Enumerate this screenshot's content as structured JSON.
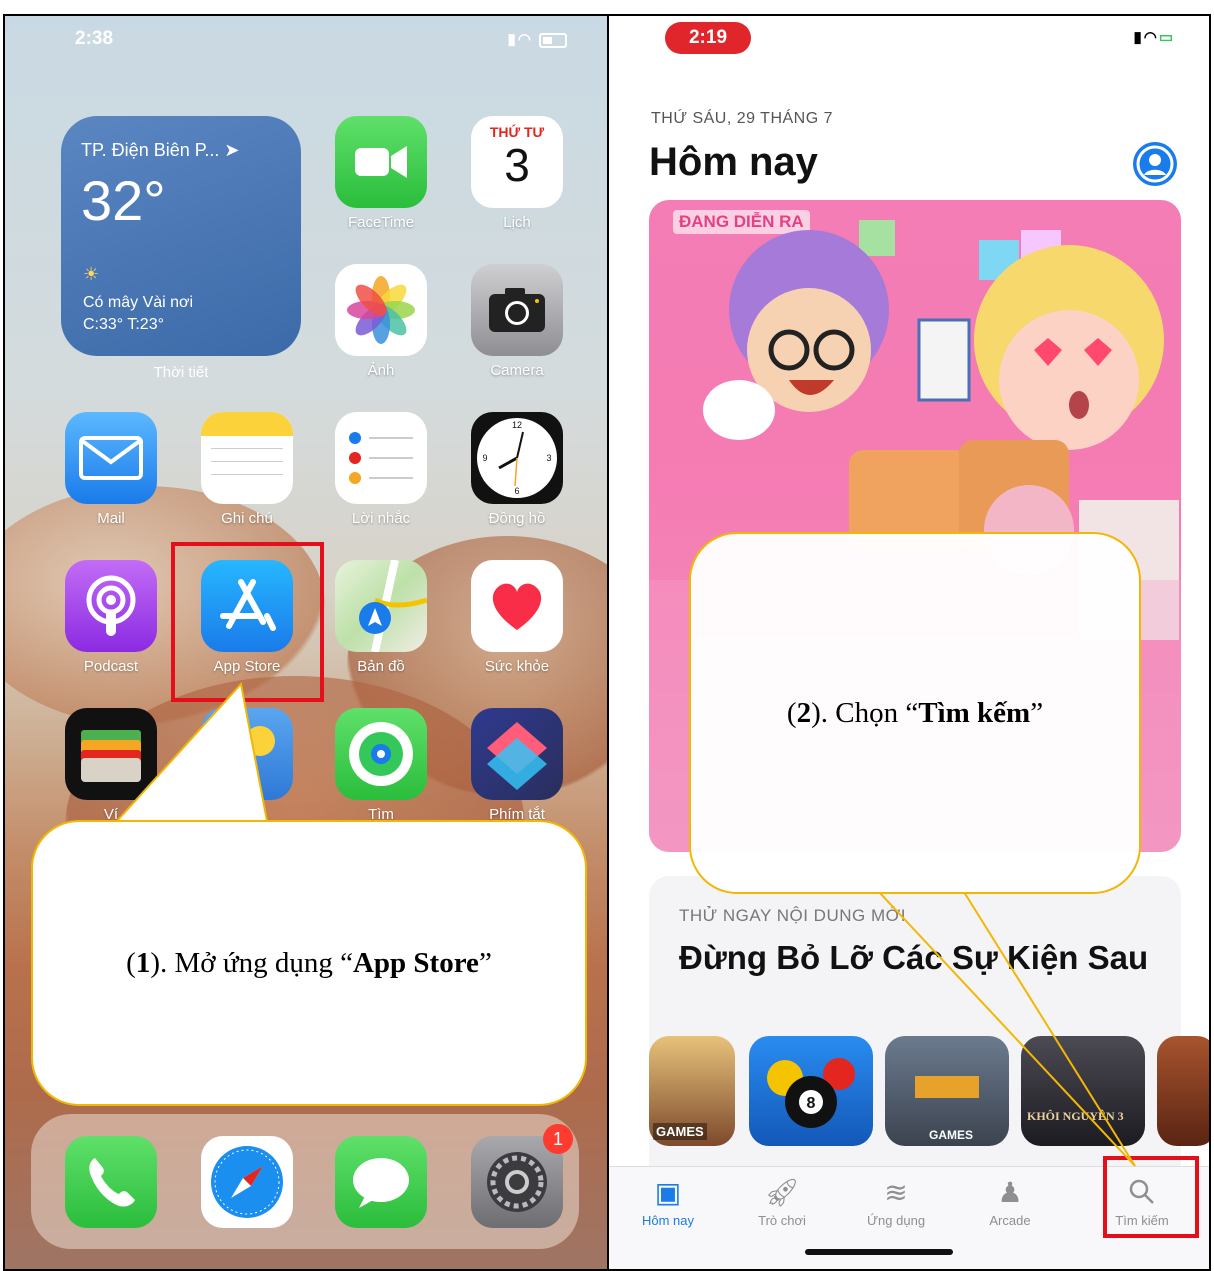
{
  "left": {
    "status_time": "2:38",
    "widget": {
      "city": "TP. Điện Biên P... ➤",
      "temperature": "32°",
      "condition": "Có mây Vài nơi",
      "high_low": "C:33° T:23°",
      "label": "Thời tiết"
    },
    "calendar": {
      "weekday": "THỨ TƯ",
      "day": "3"
    },
    "apps_row1": [
      "FaceTime",
      "Lịch"
    ],
    "apps_row2": [
      "Ảnh",
      "Camera"
    ],
    "apps_row3": [
      "Mail",
      "Ghi chú",
      "Lời nhắc",
      "Đồng hồ"
    ],
    "apps_row4": [
      "Podcast",
      "App Store",
      "Bản đồ",
      "Sức khỏe"
    ],
    "apps_row5_partial": [
      "Ví",
      "Tìm",
      "Phím tắt"
    ],
    "settings_badge": "1",
    "callout": {
      "prefix": "(",
      "step": "1",
      "text": "). Mở ứng dụng “",
      "highlight": "App Store",
      "suffix": "”"
    }
  },
  "right": {
    "status_time": "2:19",
    "date": "THỨ SÁU, 29 THÁNG 7",
    "title": "Hôm nay",
    "card1_label": "ĐANG DIỄN RA",
    "card2_label": "THỬ NGAY NỘI DUNG MỚI",
    "card2_title": "Đừng Bỏ Lỡ Các Sự Kiện Sau",
    "game_labels": [
      "GAMES",
      "GAMES",
      "KHÔI NGUYÊN 3"
    ],
    "tabs": [
      "Hôm nay",
      "Trò chơi",
      "Ứng dụng",
      "Arcade",
      "Tìm kiếm"
    ],
    "callout": {
      "prefix": "(",
      "step": "2",
      "text": "). Chọn “",
      "highlight": "Tìm kếm",
      "suffix": "”"
    }
  },
  "colors": {
    "callout_border": "#f2b705",
    "highlight_box": "#e3101c",
    "app_store_blue": "#1a7bea"
  }
}
